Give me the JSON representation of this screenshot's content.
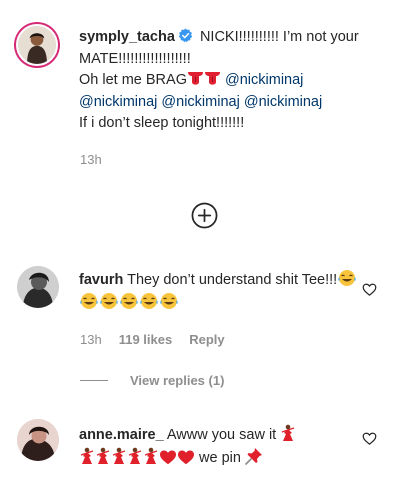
{
  "post": {
    "username": "symply_tacha",
    "text_part1": " NICKI!!!!!!!!!! I’m not your MATE!!!!!!!!!!!!!!!!!!",
    "text_part2": "Oh let me BRAG",
    "mention1": "@nickiminaj",
    "mention2": "@nickiminaj",
    "mention3": "@nickiminaj",
    "mention4": "@nickiminaj",
    "text_part3": "If i don’t sleep tonight!!!!!!!",
    "time": "13h"
  },
  "comments": [
    {
      "username": "favurh",
      "text": " They don’t understand shit Tee!!!",
      "time": "13h",
      "likes": "119 likes",
      "reply": "Reply",
      "view_replies": "View replies (1)"
    },
    {
      "username": "anne.maire_",
      "text": " Awww you saw it",
      "text_end": " we pin"
    }
  ],
  "icons": {
    "verified": "verified-badge-icon",
    "add": "plus-circle-icon",
    "like": "heart-outline-icon",
    "tongue": "tongue-emoji",
    "laugh": "tears-of-joy-emoji",
    "dancer": "dancer-emoji",
    "red_heart": "red-heart-emoji",
    "pin": "pushpin-emoji"
  },
  "colors": {
    "text": "#262626",
    "muted": "#8e8e8e",
    "mention": "#00376b",
    "verified": "#3897f0",
    "heart": "#e0245e"
  }
}
